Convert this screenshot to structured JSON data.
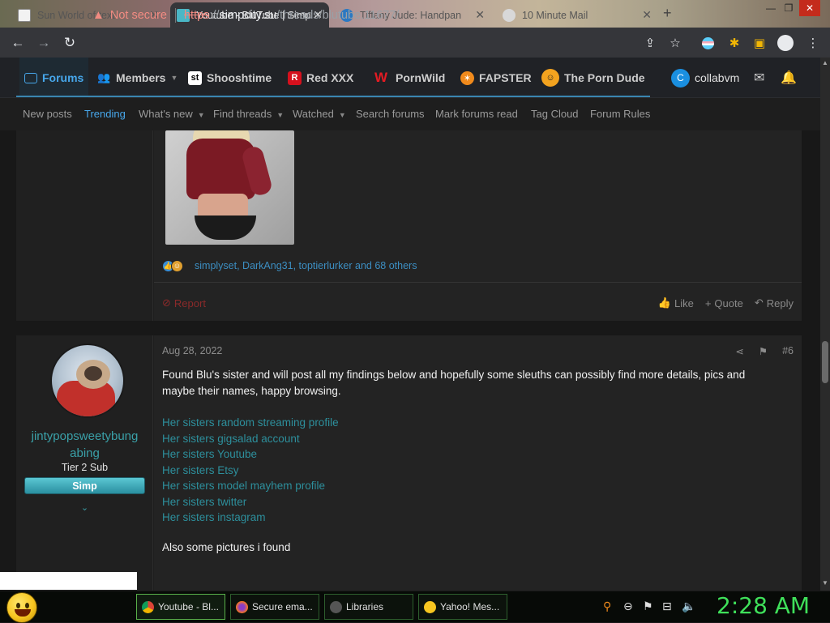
{
  "browser": {
    "tabs": [
      {
        "title": "Sun World of text",
        "active": false
      },
      {
        "title": "Youtube - BluTube | Simp",
        "active": true
      },
      {
        "title": "Tiffany Jude: Handpan",
        "active": false
      },
      {
        "title": "10 Minute Mail",
        "active": false
      }
    ],
    "address": {
      "warning": "Not secure",
      "protocol": "https",
      "host_sep": "://",
      "host": "simpcity.su",
      "path": "/threads/blutube.11677/"
    }
  },
  "forum_nav": {
    "items": [
      {
        "label": "Forums",
        "icon": "forums-icon"
      },
      {
        "label": "Members",
        "icon": "members-icon"
      },
      {
        "label": "Shooshtime",
        "icon": "shooshtime-logo"
      },
      {
        "label": "Red XXX",
        "icon": "redxxx-logo"
      },
      {
        "label": "PornWild",
        "icon": "pornwild-logo"
      },
      {
        "label": "FAPSTER",
        "icon": "fapster-logo"
      },
      {
        "label": "The Porn Dude",
        "icon": "porndude-logo"
      },
      {
        "label": "collabvm",
        "icon": "collabvm-avatar"
      }
    ],
    "sub_items": [
      {
        "label": "New posts"
      },
      {
        "label": "Trending"
      },
      {
        "label": "What's new"
      },
      {
        "label": "Find threads"
      },
      {
        "label": "Watched"
      },
      {
        "label": "Search forums"
      },
      {
        "label": "Mark forums read"
      },
      {
        "label": "Tag Cloud"
      },
      {
        "label": "Forum Rules"
      }
    ]
  },
  "prev_post": {
    "reactions_text": "simplyset, DarkAng31, toptierlurker and 68 others",
    "report": "Report",
    "actions": {
      "like": "Like",
      "quote": "Quote",
      "reply": "Reply"
    }
  },
  "post": {
    "user": {
      "name": "jintypopsweetybungabing",
      "name_line1": "jintypopsweetybung",
      "name_line2": "abing",
      "title": "Tier 2 Sub",
      "badge": "Simp"
    },
    "date": "Aug 28, 2022",
    "number": "#6",
    "body": "Found Blu's sister and will post all my findings below and hopefully some sleuths can possibly find more details, pics and maybe their names, happy browsing.",
    "links": [
      "Her sisters random streaming profile",
      "Her sisters gigsalad account",
      "Her sisters Youtube",
      "Her sisters Etsy",
      "Her sisters model mayhem profile",
      "Her sisters twitter",
      "Her sisters instagram"
    ],
    "footer_text": "Also some pictures i found"
  },
  "taskbar": {
    "tasks": [
      {
        "label": "Youtube - Bl...",
        "icon": "chrome-icon"
      },
      {
        "label": "Secure ema...",
        "icon": "firefox-icon"
      },
      {
        "label": "Libraries",
        "icon": "libraries-icon"
      },
      {
        "label": "Yahoo! Mes...",
        "icon": "yahoo-messenger-icon"
      }
    ],
    "clock": "2:28 AM"
  },
  "colors": {
    "accent": "#47a7eb",
    "link": "#2d8f9c",
    "clock": "#3fe05a",
    "badge": "#3fb0c0"
  }
}
